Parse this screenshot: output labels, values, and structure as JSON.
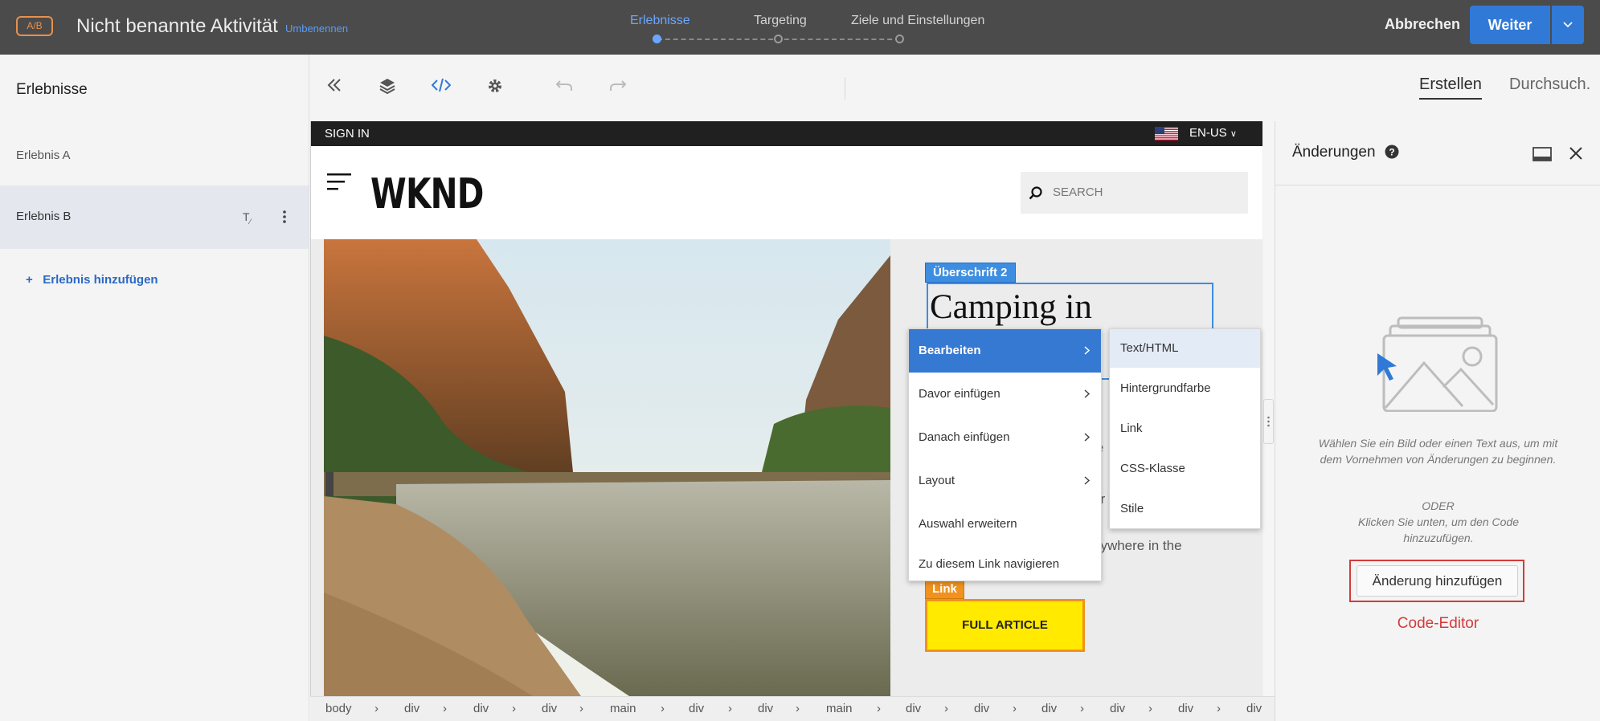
{
  "app": {
    "badge": "A/B",
    "activity_title": "Nicht benannte Aktivität",
    "rename_link": "Umbenennen",
    "steps": [
      "Erlebnisse",
      "Targeting",
      "Ziele und Einstellungen"
    ],
    "active_step": 0,
    "cancel_label": "Abbrechen",
    "next_label": "Weiter",
    "accent": "#3179d6"
  },
  "sidebar": {
    "title": "Erlebnisse",
    "items": [
      {
        "label": "Erlebnis A",
        "selected": false
      },
      {
        "label": "Erlebnis B",
        "selected": true
      }
    ],
    "add_label": "+   Erlebnis hinzufügen"
  },
  "toolbar": {
    "icons": [
      "collapse-left-icon",
      "layers-icon",
      "code-icon",
      "gear-icon",
      "undo-icon",
      "redo-icon"
    ],
    "tabs": [
      "Erstellen",
      "Durchsuch."
    ],
    "active_tab": 0
  },
  "site": {
    "sign_in": "SIGN IN",
    "language": "EN-US",
    "logo": "WKND",
    "search_placeholder": "SEARCH",
    "heading_tag": "Überschrift 2",
    "heading_text": "Camping in",
    "heading_partial": "s",
    "body_fragments": [
      "o",
      "le",
      "y",
      "ar",
      "o",
      "nywhere in the"
    ],
    "link_tag": "Link",
    "button_label": "FULL ARTICLE"
  },
  "context_menu": {
    "items": [
      {
        "label": "Bearbeiten",
        "has_submenu": true,
        "active": true
      },
      {
        "label": "Davor einfügen",
        "has_submenu": true
      },
      {
        "label": "Danach einfügen",
        "has_submenu": true
      },
      {
        "label": "Layout",
        "has_submenu": true
      },
      {
        "label": "Auswahl erweitern",
        "has_submenu": false
      },
      {
        "label": "Zu diesem Link navigieren",
        "has_submenu": false
      }
    ],
    "submenu": [
      "Text/HTML",
      "Hintergrundfarbe",
      "Link",
      "CSS-Klasse",
      "Stile"
    ],
    "submenu_active": 0
  },
  "breadcrumb": {
    "items": [
      "body",
      "div",
      "div",
      "div",
      "main",
      "div",
      "div",
      "main",
      "div",
      "div",
      "div",
      "div",
      "div",
      "div"
    ],
    "active": "a"
  },
  "changes_panel": {
    "title": "Änderungen",
    "hint": "Wählen Sie ein Bild oder einen Text aus, um mit dem Vornehmen von Änderungen zu beginnen.",
    "or": "ODER",
    "hint2": "Klicken Sie unten, um den Code hinzuzufügen.",
    "add_button": "Änderung hinzufügen",
    "annotation": "Code-Editor",
    "annotation_color": "#d33b3b"
  }
}
